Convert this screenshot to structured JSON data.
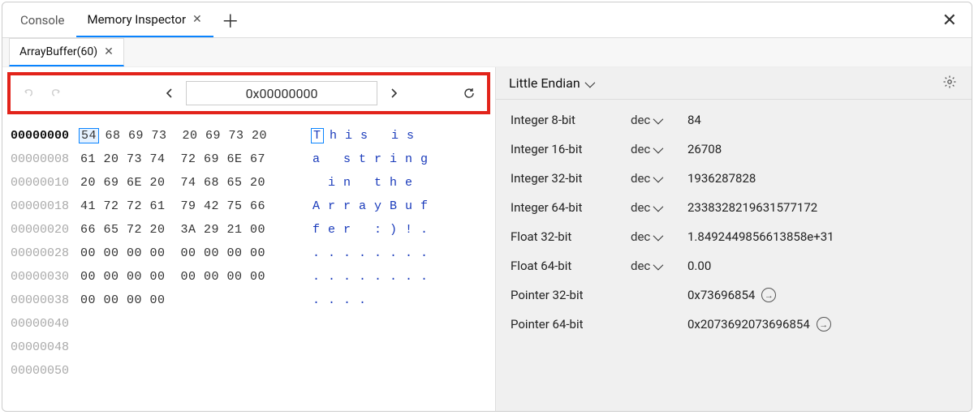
{
  "tabs": {
    "console": "Console",
    "memory": "Memory Inspector"
  },
  "subtab": {
    "label": "ArrayBuffer(60)"
  },
  "nav": {
    "address": "0x00000000"
  },
  "hex": {
    "rows": [
      {
        "addr": "00000000",
        "bytes_pre": "",
        "sel": "54",
        "bytes_post": " 68 69 73  20 69 73 20",
        "ascii_pre": "",
        "ascii_sel": "T",
        "ascii_post": " h i s   i s  ",
        "selected": true
      },
      {
        "addr": "00000008",
        "bytes": "61 20 73 74  72 69 6E 67",
        "ascii": "a   s t r i n g"
      },
      {
        "addr": "00000010",
        "bytes": "20 69 6E 20  74 68 65 20",
        "ascii": "  i n   t h e  "
      },
      {
        "addr": "00000018",
        "bytes": "41 72 72 61  79 42 75 66",
        "ascii": "A r r a y B u f"
      },
      {
        "addr": "00000020",
        "bytes": "66 65 72 20  3A 29 21 00",
        "ascii": "f e r   : ) ! ."
      },
      {
        "addr": "00000028",
        "bytes": "00 00 00 00  00 00 00 00",
        "ascii": ". . . . . . . ."
      },
      {
        "addr": "00000030",
        "bytes": "00 00 00 00  00 00 00 00",
        "ascii": ". . . . . . . ."
      },
      {
        "addr": "00000038",
        "bytes": "00 00 00 00",
        "ascii": ". . . ."
      },
      {
        "addr": "00000040",
        "bytes": "",
        "ascii": ""
      },
      {
        "addr": "00000048",
        "bytes": "",
        "ascii": ""
      },
      {
        "addr": "00000050",
        "bytes": "",
        "ascii": ""
      }
    ]
  },
  "endian": {
    "label": "Little Endian"
  },
  "interp": [
    {
      "label": "Integer 8-bit",
      "fmt": "dec",
      "val": "84"
    },
    {
      "label": "Integer 16-bit",
      "fmt": "dec",
      "val": "26708"
    },
    {
      "label": "Integer 32-bit",
      "fmt": "dec",
      "val": "1936287828"
    },
    {
      "label": "Integer 64-bit",
      "fmt": "dec",
      "val": "2338328219631577172"
    },
    {
      "label": "Float 32-bit",
      "fmt": "dec",
      "val": "1.8492449856613858e+31"
    },
    {
      "label": "Float 64-bit",
      "fmt": "dec",
      "val": "0.00"
    },
    {
      "label": "Pointer 32-bit",
      "fmt": "",
      "val": "0x73696854",
      "jump": true
    },
    {
      "label": "Pointer 64-bit",
      "fmt": "",
      "val": "0x2073692073696854",
      "jump": true
    }
  ]
}
